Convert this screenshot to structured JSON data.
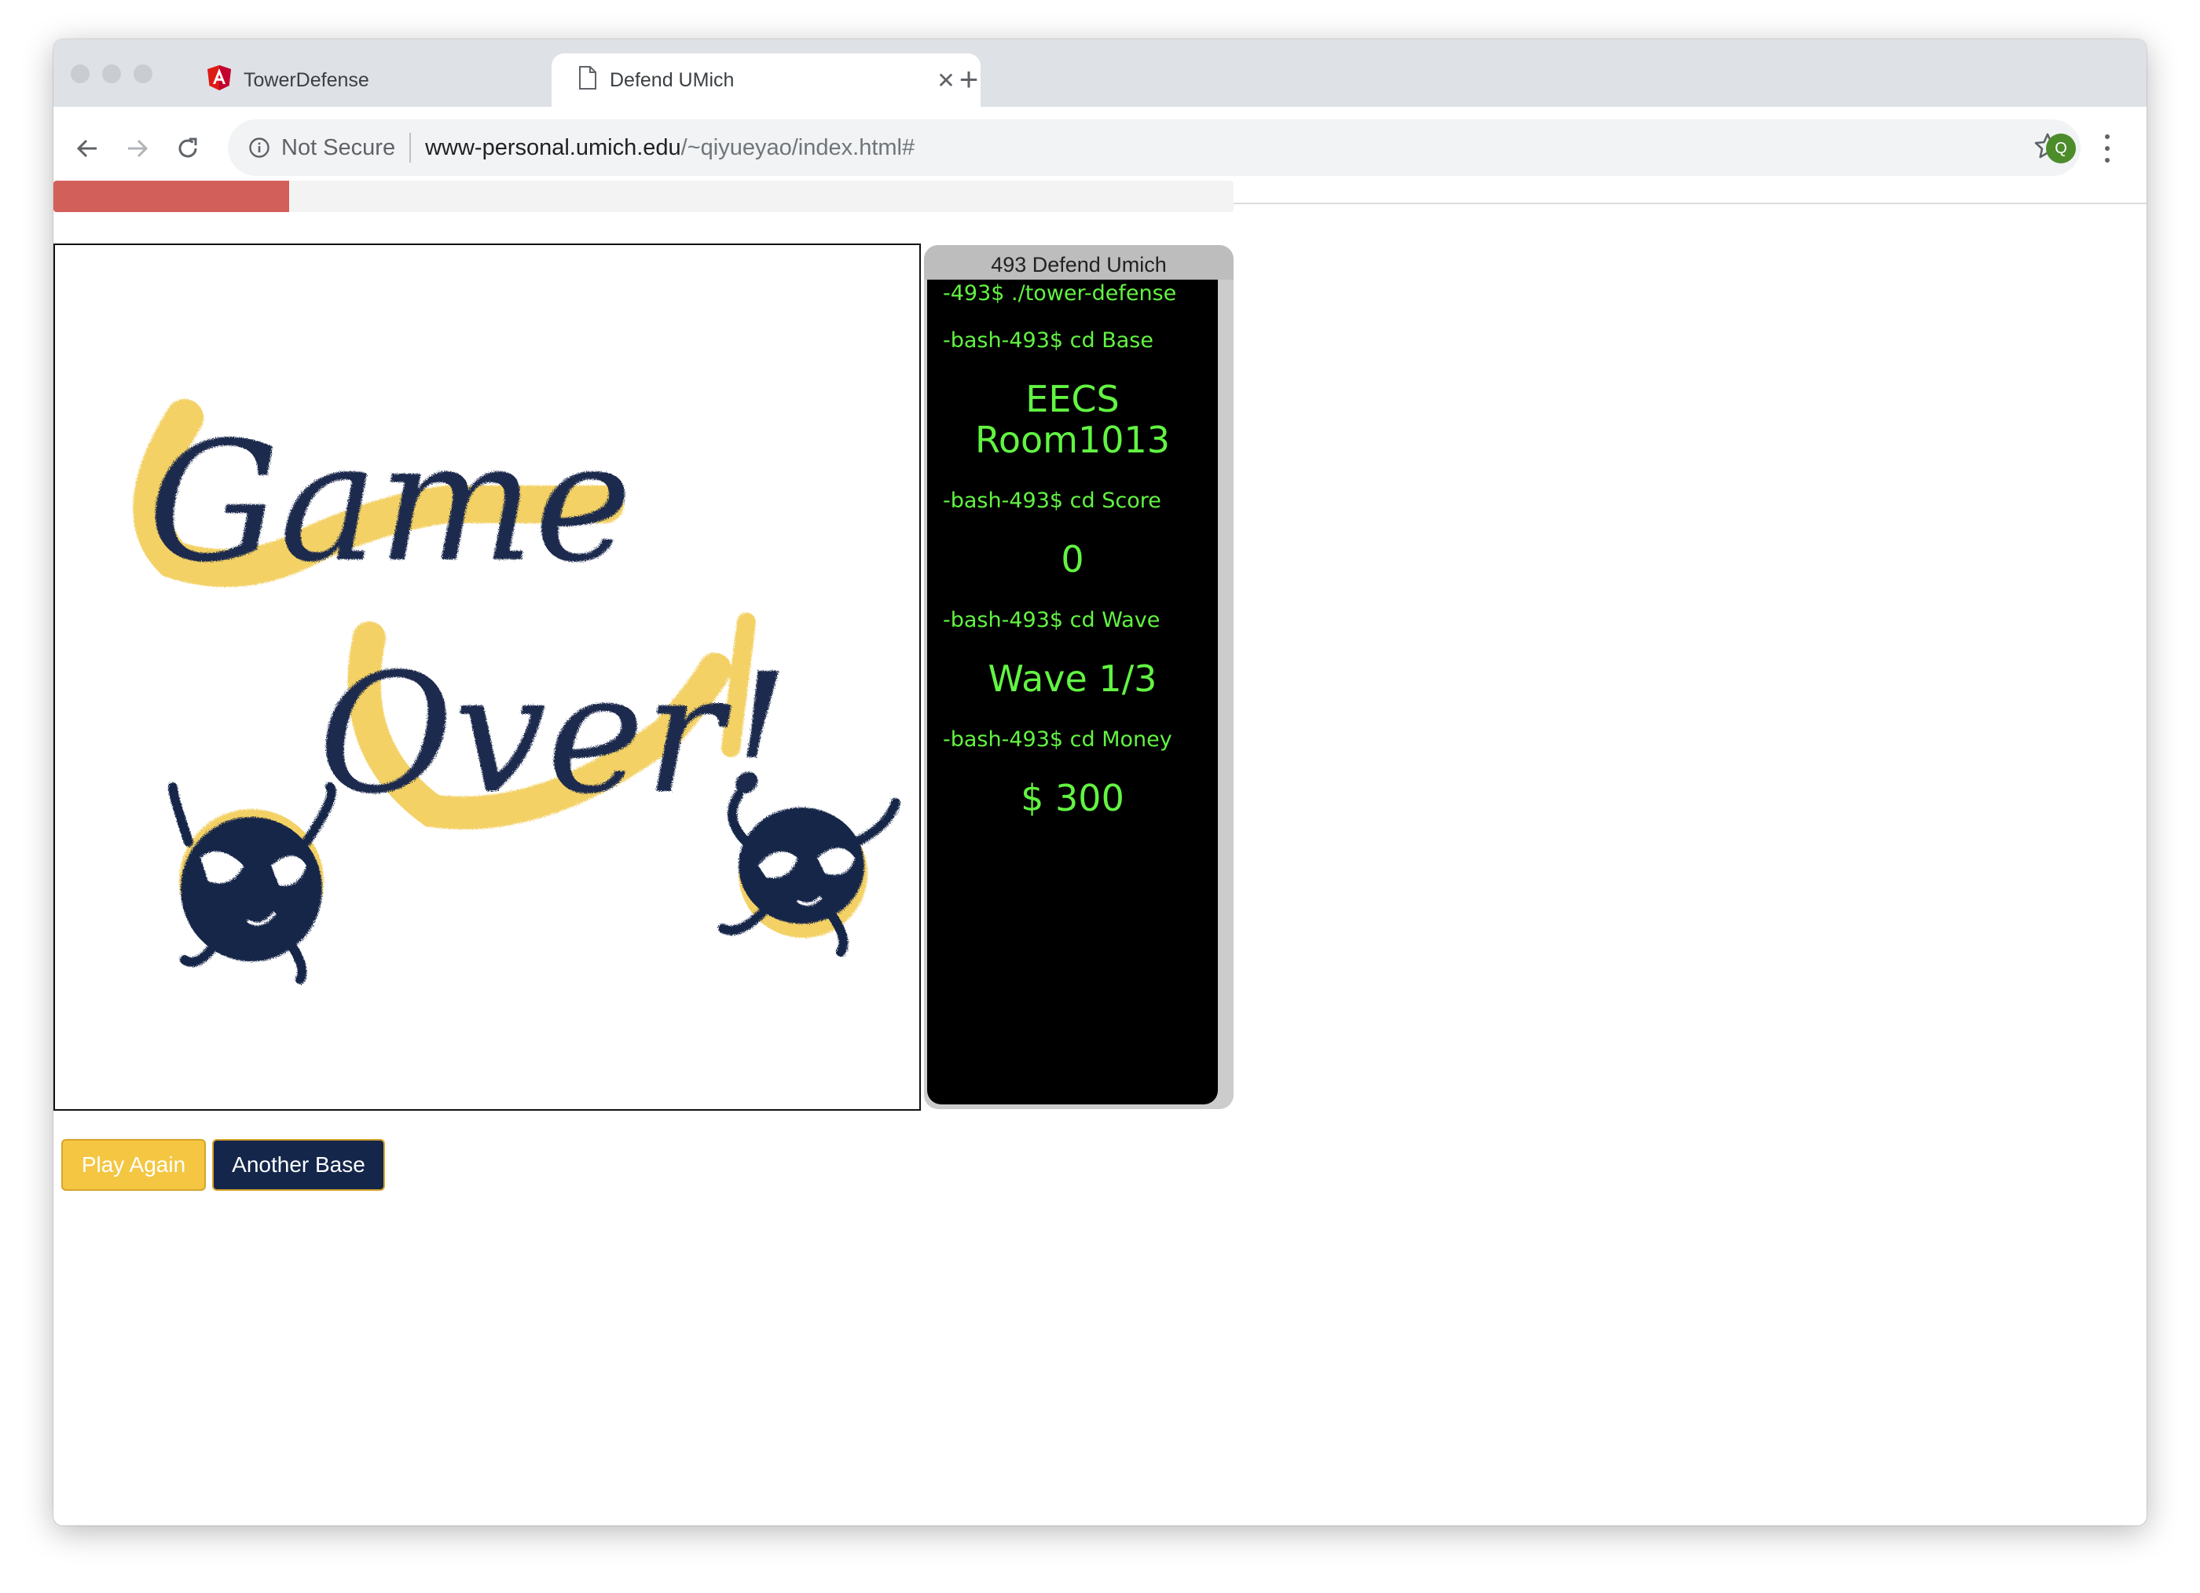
{
  "browser": {
    "tabs": [
      {
        "title": "TowerDefense",
        "icon": "angular-icon"
      },
      {
        "title": "Defend UMich",
        "icon": "page-icon"
      }
    ],
    "address": {
      "security_label": "Not Secure",
      "url_host": "www-personal.umich.edu",
      "url_path": "/~qiyueyao/index.html#"
    },
    "profile_initial": "Q"
  },
  "page": {
    "progress_fraction": 0.2,
    "progress_color": "#d35f5a",
    "game_over": {
      "line1": "Game",
      "line2": "Over!"
    },
    "terminal": {
      "title": "493 Defend Umich",
      "lines": [
        "-493$ ./tower-defense",
        "-bash-493$ cd Base",
        "-bash-493$ cd Score",
        "-bash-493$ cd Wave",
        "-bash-493$ cd Money"
      ],
      "base_line1": "EECS",
      "base_line2": "Room1013",
      "score": "0",
      "wave": "Wave 1/3",
      "money": "$ 300",
      "text_color": "#62f442"
    },
    "buttons": {
      "play_again": "Play Again",
      "another_base": "Another Base"
    },
    "colors": {
      "accent_yellow": "#f4c642",
      "navy": "#14264a"
    }
  }
}
